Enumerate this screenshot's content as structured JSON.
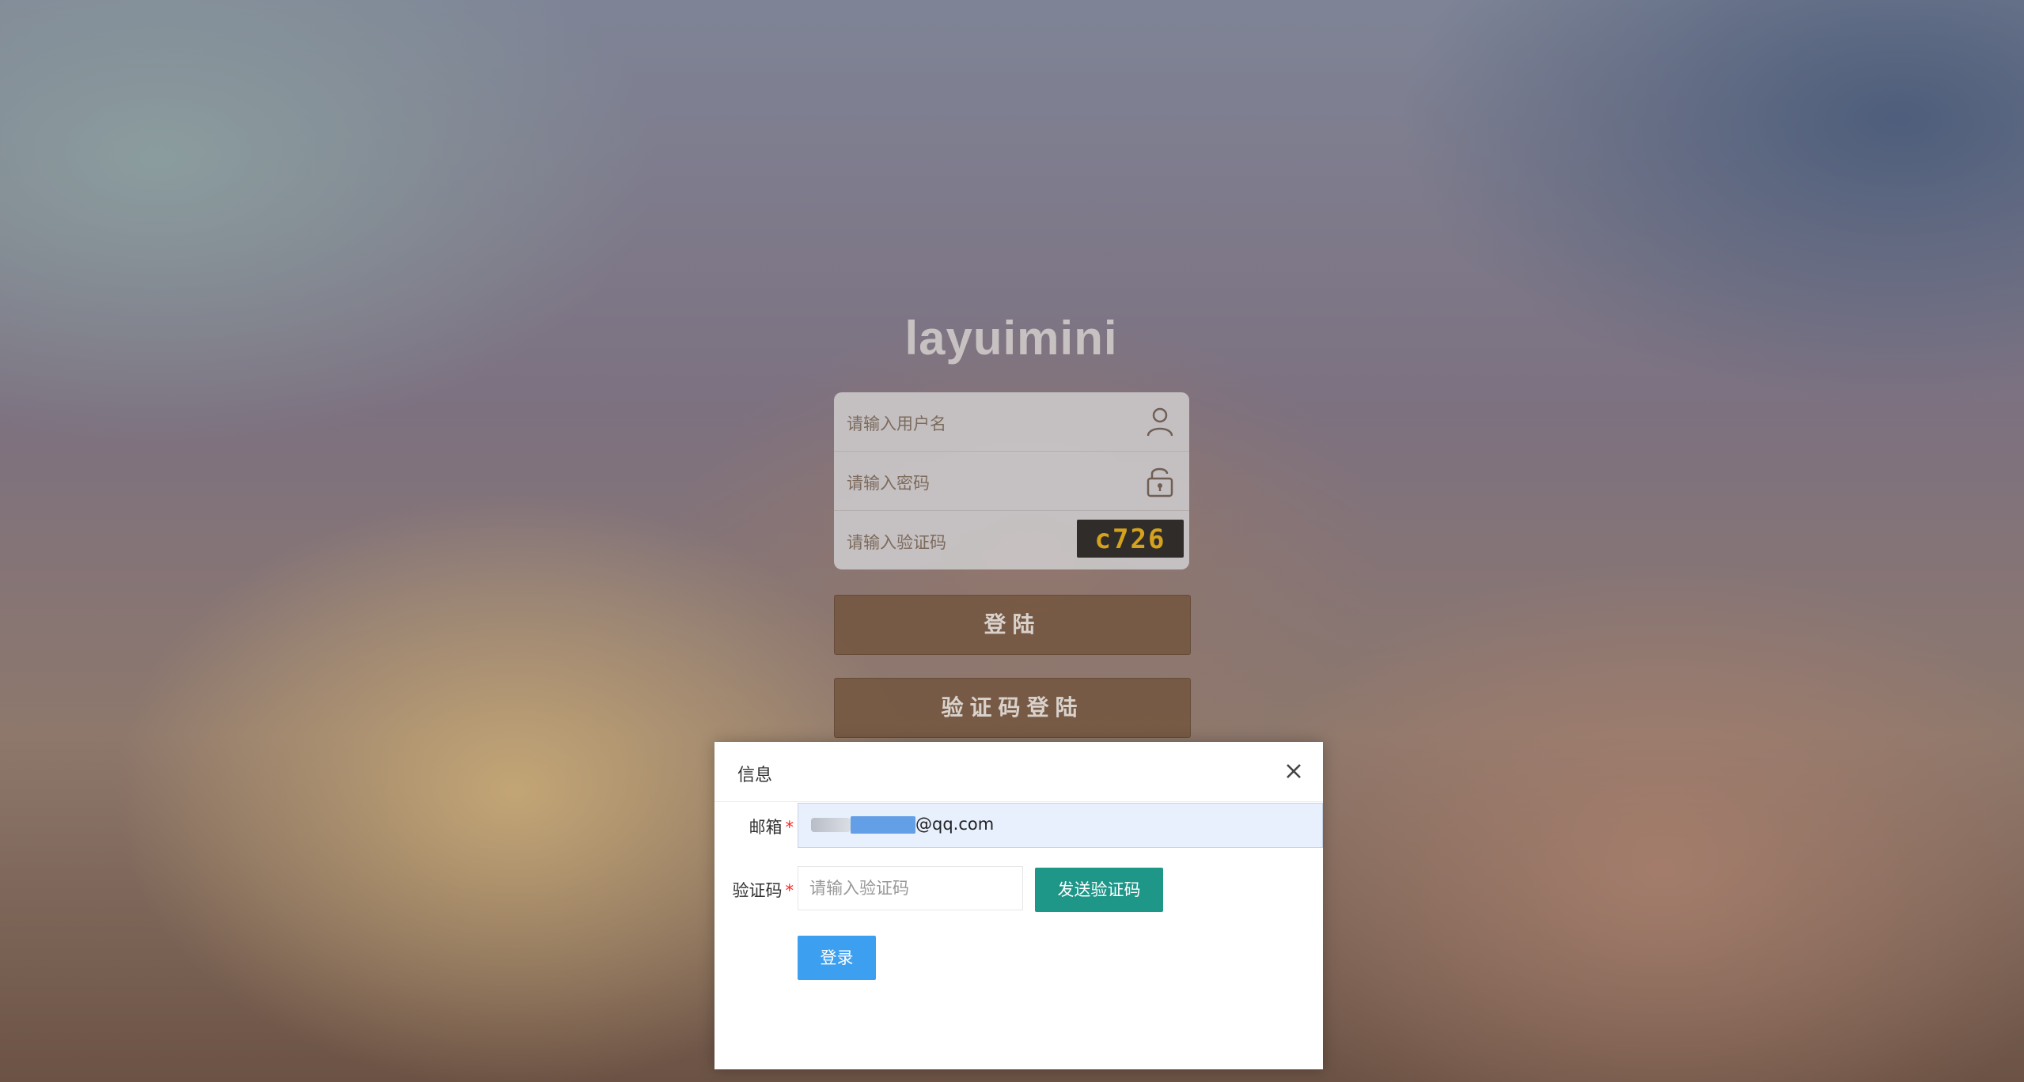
{
  "app_title": "layuimini",
  "login_form": {
    "username_placeholder": "请输入用户名",
    "password_placeholder": "请输入密码",
    "captcha_placeholder": "请输入验证码",
    "captcha_text": "c726",
    "username_icon": "user-icon",
    "password_icon": "unlock-icon"
  },
  "buttons": {
    "login_label": "登陆",
    "code_login_label": "验证码登陆"
  },
  "dialog": {
    "title": "信息",
    "close_icon": "close-icon",
    "email_label": "邮箱",
    "email_value_suffix": "@qq.com",
    "code_label": "验证码",
    "required_mark": "*",
    "code_placeholder": "请输入验证码",
    "send_code_label": "发送验证码",
    "submit_label": "登录"
  },
  "colors": {
    "send_button": "#1e9688",
    "submit_button": "#3d9ff0",
    "required": "#ff2222",
    "primary_buttons": "#745640"
  }
}
